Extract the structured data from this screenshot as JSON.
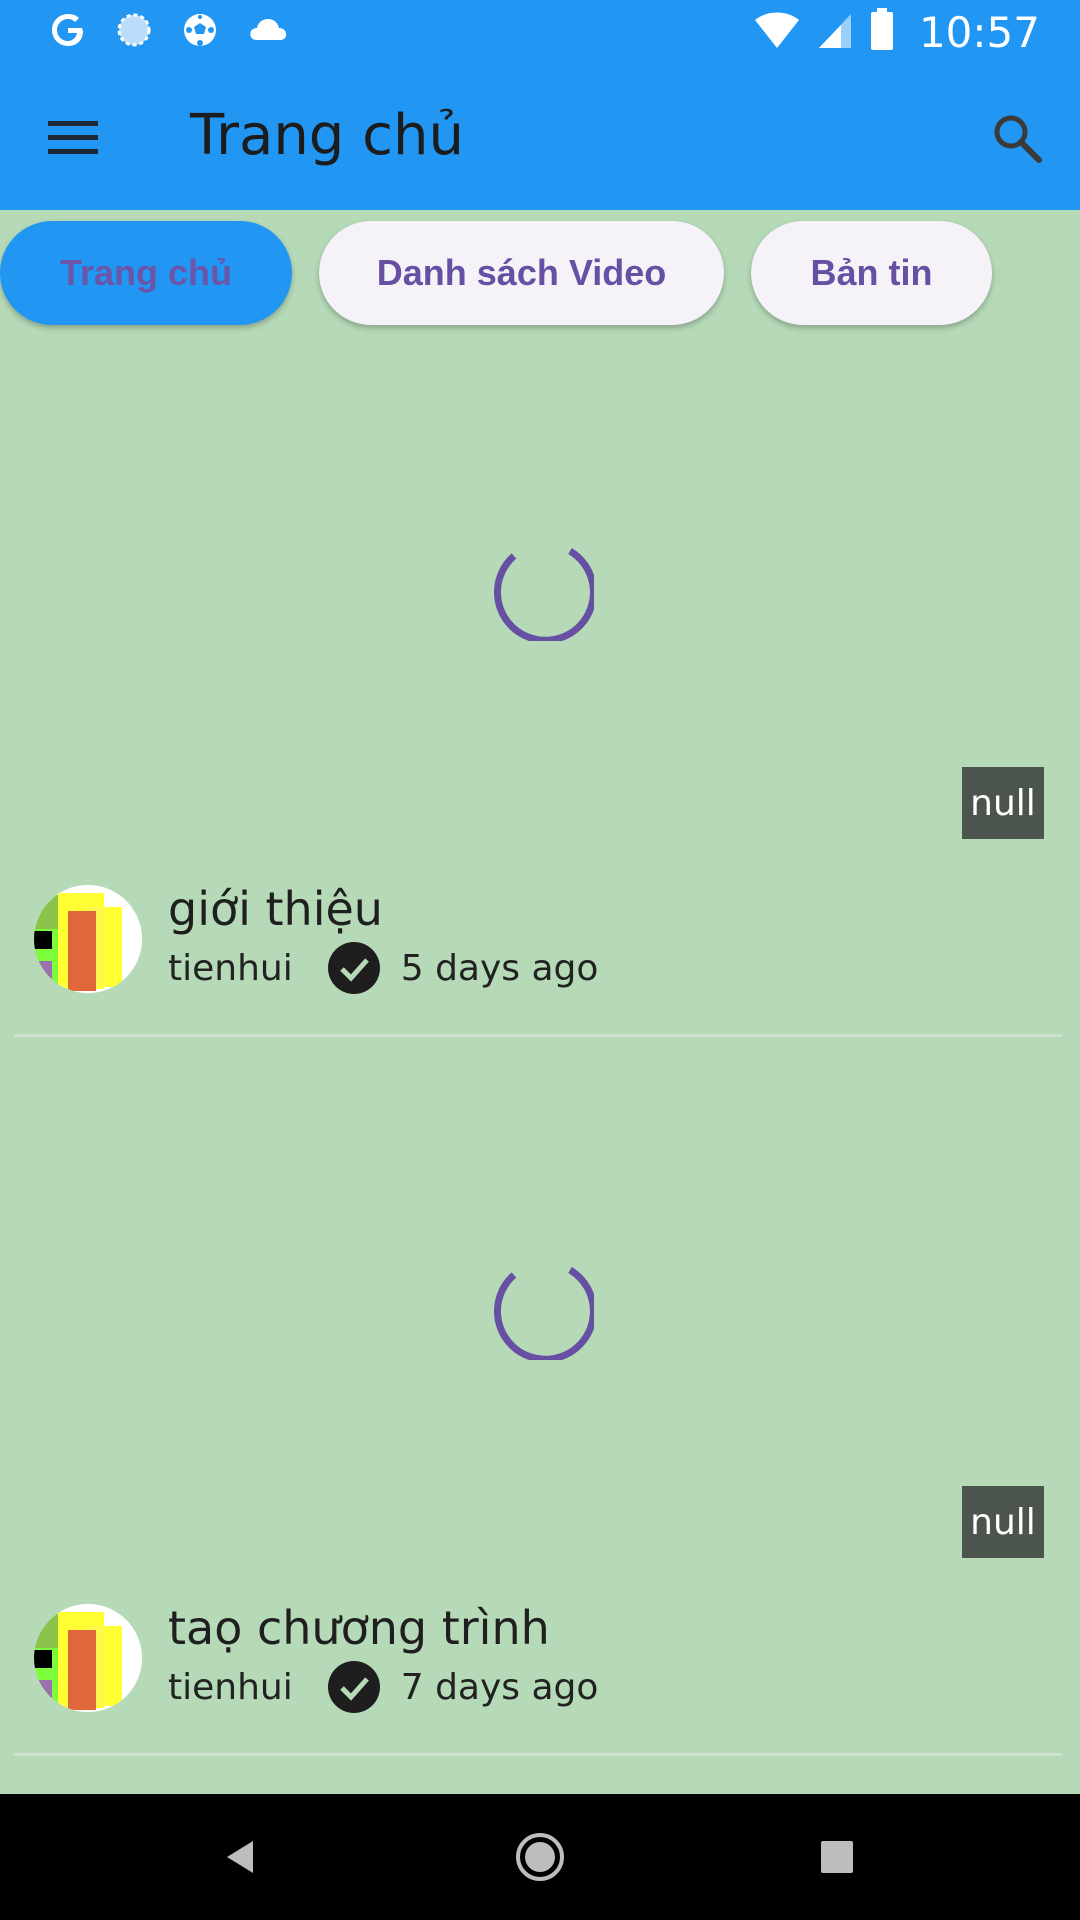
{
  "status_bar": {
    "time": "10:57",
    "icons": [
      "google-icon",
      "sync-icon",
      "soccer-ball-icon",
      "cloud-icon",
      "wifi-icon",
      "cell-signal-icon",
      "battery-icon"
    ]
  },
  "app_bar": {
    "title": "Trang chủ",
    "menu_icon": "menu-icon",
    "search_icon": "search-icon",
    "color": "#2196F3"
  },
  "chips": [
    {
      "label": "Trang chủ",
      "selected": true
    },
    {
      "label": "Danh sách Video",
      "selected": false
    },
    {
      "label": "Bản tin",
      "selected": false
    }
  ],
  "videos": [
    {
      "badge": "null",
      "title": "giới thiệu",
      "channel": "tienhui",
      "time_ago": "5 days ago",
      "verified_icon": "check-circle-icon"
    },
    {
      "badge": "null",
      "title": "taọ chương trình",
      "channel": "tienhui",
      "time_ago": "7 days ago",
      "verified_icon": "check-circle-icon"
    }
  ],
  "colors": {
    "background": "#B6DAB8",
    "accent": "#6750A4",
    "badge": "#4B554D"
  },
  "nav_bar": {
    "icons": [
      "back-icon",
      "home-icon",
      "recents-icon"
    ]
  }
}
